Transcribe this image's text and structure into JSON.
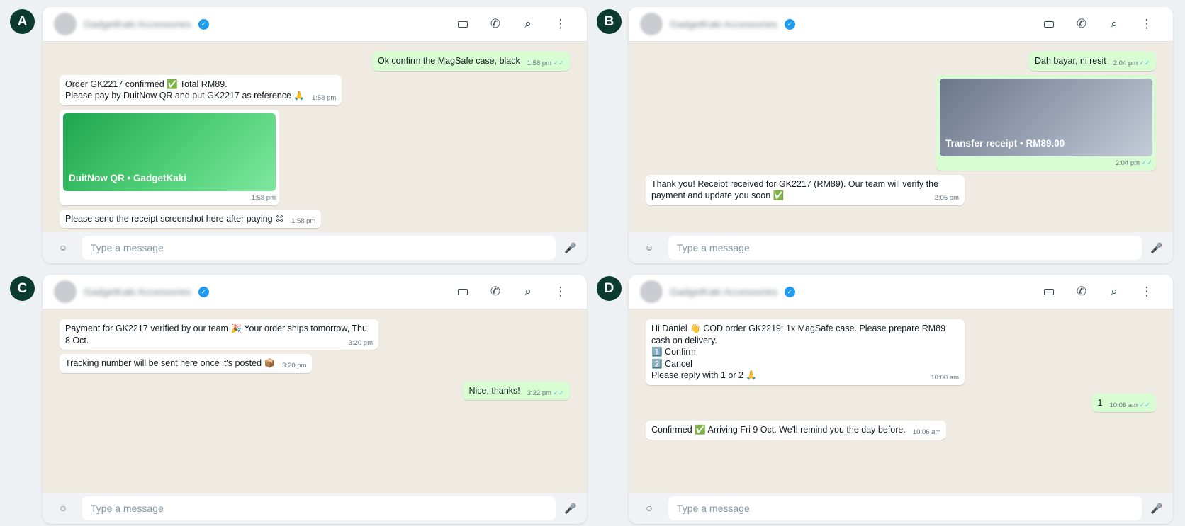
{
  "contact": {
    "name": "GadgetKaki Accessories",
    "verified_mark": "✓"
  },
  "icons": {
    "video": "video-icon",
    "call": "phone-icon",
    "search": "search-icon",
    "menu": "kebab-menu-icon",
    "emoji": "emoji-icon",
    "mic": "mic-icon",
    "tick": "double-tick-icon"
  },
  "glyphs": {
    "call": "✆",
    "search": "⌕",
    "menu": "⋮",
    "emoji": "☺",
    "mic": "🎤",
    "tick": "✓✓"
  },
  "colors": {
    "badge": "#0b3b2e",
    "chat_bg": "#efeae2",
    "outgoing": "#d9fdd3",
    "incoming": "#ffffff",
    "tick": "#53bdeb",
    "verified": "#1d9bf0"
  },
  "input_placeholder": "Type a message",
  "panels": [
    {
      "label": "A",
      "messages": [
        {
          "dir": "out",
          "text": "Ok confirm the MagSafe case, black",
          "time": "1:58 pm",
          "read": true
        },
        {
          "dir": "in",
          "text": "Order GK2217 confirmed ✅ Total RM89.\nPlease pay by DuitNow QR and put GK2217 as reference 🙏",
          "time": "1:58 pm"
        },
        {
          "dir": "in",
          "type": "image",
          "style": "qr",
          "caption": "DuitNow QR  •  GadgetKaki",
          "time": "1:58 pm"
        },
        {
          "dir": "in",
          "text": "Please send the receipt screenshot here after paying 😊",
          "time": "1:58 pm"
        }
      ]
    },
    {
      "label": "B",
      "messages": [
        {
          "dir": "out",
          "text": "Dah bayar, ni resit",
          "time": "2:04 pm",
          "read": true
        },
        {
          "dir": "out",
          "type": "image",
          "style": "receipt",
          "caption": "Transfer receipt  •  RM89.00",
          "time": "2:04 pm",
          "read": true
        },
        {
          "dir": "in",
          "text": "Thank you! Receipt received for GK2217 (RM89). Our team will verify the payment and update you soon ✅",
          "time": "2:05 pm"
        }
      ]
    },
    {
      "label": "C",
      "messages": [
        {
          "dir": "in",
          "text": "Payment for GK2217 verified by our team 🎉 Your order ships tomorrow, Thu 8 Oct.",
          "time": "3:20 pm"
        },
        {
          "dir": "in",
          "text": "Tracking number will be sent here once it's posted 📦",
          "time": "3:20 pm"
        },
        {
          "dir": "out",
          "text": "Nice, thanks!",
          "time": "3:22 pm",
          "read": true,
          "gap": true
        }
      ]
    },
    {
      "label": "D",
      "messages": [
        {
          "dir": "in",
          "text": "Hi Daniel 👋 COD order GK2219: 1x MagSafe case. Please prepare RM89 cash on delivery.\n1️⃣ Confirm\n2️⃣ Cancel\nPlease reply with 1 or 2 🙏",
          "time": "10:00 am"
        },
        {
          "dir": "out",
          "text": "1",
          "time": "10:06 am",
          "read": true,
          "gap": true
        },
        {
          "dir": "in",
          "text": "Confirmed ✅ Arriving Fri 9 Oct. We'll remind you the day before.",
          "time": "10:06 am",
          "gap": true
        }
      ]
    }
  ]
}
